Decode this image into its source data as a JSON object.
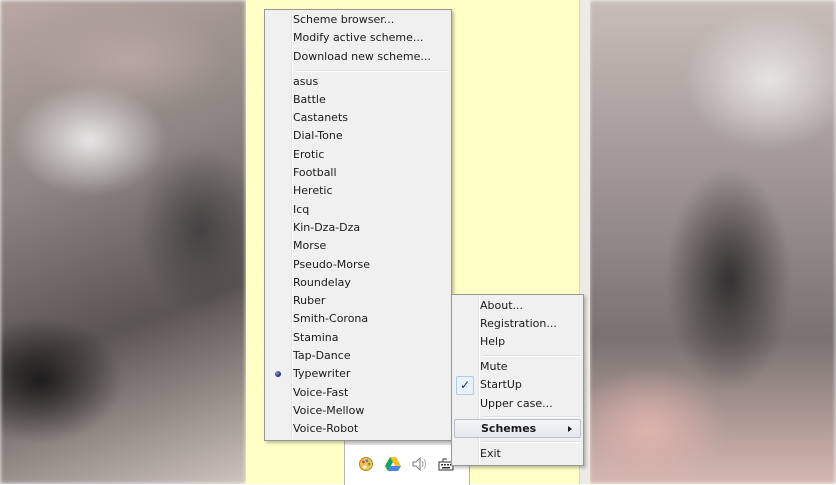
{
  "scheme_menu": {
    "actions": [
      "Scheme browser...",
      "Modify active scheme...",
      "Download new scheme..."
    ],
    "schemes": [
      "asus",
      "Battle",
      "Castanets",
      "Dial-Tone",
      "Erotic",
      "Football",
      "Heretic",
      "Icq",
      "Kin-Dza-Dza",
      "Morse",
      "Pseudo-Morse",
      "Roundelay",
      "Ruber",
      "Smith-Corona",
      "Stamina",
      "Tap-Dance",
      "Typewriter",
      "Voice-Fast",
      "Voice-Mellow",
      "Voice-Robot"
    ],
    "selected": "Typewriter"
  },
  "context_menu": {
    "about": "About...",
    "registration": "Registration...",
    "help": "Help",
    "mute": "Mute",
    "startup": "StartUp",
    "startup_checked": "✓",
    "upper_case": "Upper case...",
    "schemes": "Schemes",
    "exit": "Exit"
  },
  "tray_icons": [
    "paint-palette-icon",
    "google-drive-icon",
    "speaker-icon",
    "keyboard-icon"
  ],
  "colors": {
    "paper": "#ffffc6",
    "menu_bg": "#f0f0f0",
    "radio": "#1a2a78"
  }
}
